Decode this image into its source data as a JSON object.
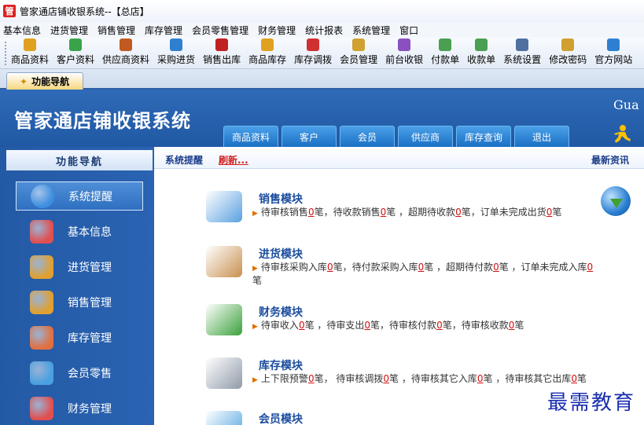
{
  "window": {
    "title": "管家通店铺收银系统--【总店】",
    "app_icon_char": "管"
  },
  "menubar": [
    "基本信息",
    "进货管理",
    "销售管理",
    "库存管理",
    "会员零售管理",
    "财务管理",
    "统计报表",
    "系统管理",
    "窗口"
  ],
  "toolbar": [
    {
      "label": "商品资料",
      "icon": "box-icon",
      "color": "#e0a020"
    },
    {
      "label": "客户资料",
      "icon": "people-icon",
      "color": "#3aa34a"
    },
    {
      "label": "供应商资料",
      "icon": "supplier-icon",
      "color": "#c05a20"
    },
    {
      "label": "采购进货",
      "icon": "truck-icon",
      "color": "#2f7fd0"
    },
    {
      "label": "销售出库",
      "icon": "cart-icon",
      "color": "#c02020"
    },
    {
      "label": "商品库存",
      "icon": "stock-icon",
      "color": "#e0a020"
    },
    {
      "label": "库存调拨",
      "icon": "transfer-icon",
      "color": "#d03030"
    },
    {
      "label": "会员管理",
      "icon": "member-icon",
      "color": "#d0a030"
    },
    {
      "label": "前台收银",
      "icon": "cashier-icon",
      "color": "#8a50c0"
    },
    {
      "label": "付款单",
      "icon": "payment-icon",
      "color": "#4aa050"
    },
    {
      "label": "收款单",
      "icon": "receipt-icon",
      "color": "#4aa050"
    },
    {
      "label": "系统设置",
      "icon": "settings-icon",
      "color": "#5070a0"
    },
    {
      "label": "修改密码",
      "icon": "key-icon",
      "color": "#d0a030"
    },
    {
      "label": "官方网站",
      "icon": "globe-icon",
      "color": "#2f7fd0"
    }
  ],
  "doc_tab": {
    "label": "功能导航"
  },
  "banner": {
    "title": "管家通店铺收银系统",
    "right_text": "Gua",
    "tabs": [
      "商品资料",
      "客户",
      "会员",
      "供应商",
      "库存查询",
      "退出"
    ]
  },
  "leftnav": {
    "header": "功能导航",
    "items": [
      {
        "label": "系统提醒",
        "icon": "info-icon",
        "color": "#3d8ee0"
      },
      {
        "label": "基本信息",
        "icon": "blocks-icon",
        "color": "#e05050"
      },
      {
        "label": "进货管理",
        "icon": "import-icon",
        "color": "#e0a030"
      },
      {
        "label": "销售管理",
        "icon": "sales-icon",
        "color": "#e0a030"
      },
      {
        "label": "库存管理",
        "icon": "warehouse-icon",
        "color": "#e07040"
      },
      {
        "label": "会员零售",
        "icon": "member-icon",
        "color": "#4aa0e0"
      },
      {
        "label": "财务管理",
        "icon": "finance-icon",
        "color": "#e05050"
      }
    ]
  },
  "content": {
    "header_left": "系统提醒",
    "refresh": "刷新...",
    "header_right": "最新资讯",
    "modules": [
      {
        "title": "销售模块",
        "icon": "book-icon",
        "color": "#5aa0e0",
        "line": [
          [
            "待审核销售",
            "0",
            "笔，待收款销售"
          ],
          [
            "",
            "0",
            "笔 ，超期待收款"
          ],
          [
            "",
            "0",
            "笔，订单未完成出货"
          ],
          [
            "",
            "0",
            "笔"
          ]
        ]
      },
      {
        "title": "进货模块",
        "icon": "package-icon",
        "color": "#c89050",
        "line": [
          [
            "待审核采购入库",
            "0",
            "笔，待付款采购入库"
          ],
          [
            "",
            "0",
            "笔 ，超期待付款"
          ],
          [
            "",
            "0",
            "笔 ，订单未完成入库"
          ],
          [
            "",
            "0",
            "笔"
          ]
        ]
      },
      {
        "title": "财务模块",
        "icon": "money-icon",
        "color": "#3aa03a",
        "line": [
          [
            "待审收入",
            "0",
            "笔 ，待审支出"
          ],
          [
            "",
            "0",
            "笔，待审核付款"
          ],
          [
            "",
            "0",
            "笔，待审核收款"
          ],
          [
            "",
            "0",
            "笔"
          ]
        ]
      },
      {
        "title": "库存模块",
        "icon": "database-icon",
        "color": "#909aa8",
        "line": [
          [
            "上下限预警",
            "0",
            "笔， 待审核调拨"
          ],
          [
            "",
            "0",
            "笔 ，待审核其它入库"
          ],
          [
            "",
            "0",
            "笔 ，待审核其它出库"
          ],
          [
            "",
            "0",
            "笔"
          ]
        ]
      },
      {
        "title": "会员模块",
        "icon": "member-icon",
        "color": "#4aa0e0",
        "line": []
      }
    ]
  },
  "watermark": "最需教育"
}
